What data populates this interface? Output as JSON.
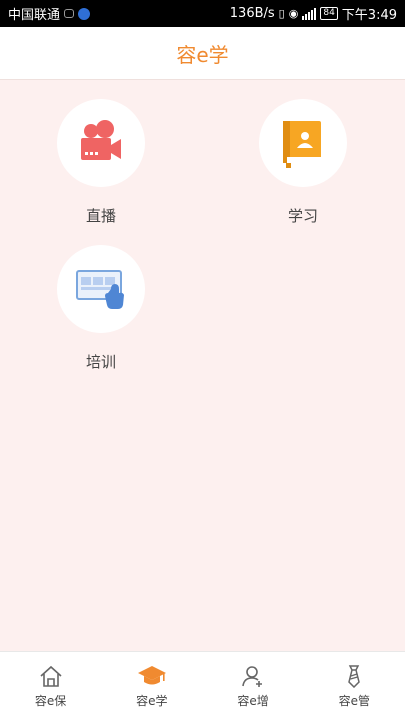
{
  "status_bar": {
    "carrier": "中国联通",
    "speed": "136B/s",
    "battery": "84",
    "time": "下午3:49"
  },
  "header": {
    "title": "容e学"
  },
  "tiles": [
    {
      "label": "直播",
      "icon": "video-camera-icon"
    },
    {
      "label": "学习",
      "icon": "book-icon"
    },
    {
      "label": "培训",
      "icon": "training-screen-icon"
    }
  ],
  "tabbar": {
    "items": [
      {
        "label": "容e保",
        "icon": "home-icon",
        "active": false
      },
      {
        "label": "容e学",
        "icon": "graduation-cap-icon",
        "active": true
      },
      {
        "label": "容e增",
        "icon": "add-user-icon",
        "active": false
      },
      {
        "label": "容e管",
        "icon": "tie-icon",
        "active": false
      }
    ]
  },
  "colors": {
    "accent": "#f08a30",
    "background": "#fdf0ef",
    "video_red": "#ef6463",
    "book_orange": "#f7a623"
  }
}
